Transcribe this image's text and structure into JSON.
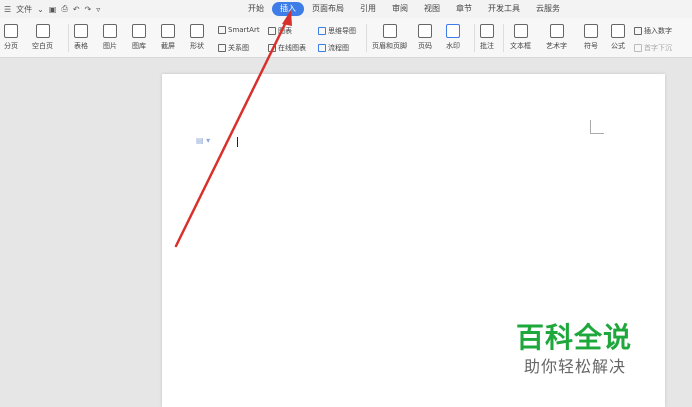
{
  "menubar": {
    "menu_label": "文件",
    "tabs": [
      {
        "label": "开始",
        "active": false
      },
      {
        "label": "插入",
        "active": true
      },
      {
        "label": "页面布局",
        "active": false
      },
      {
        "label": "引用",
        "active": false
      },
      {
        "label": "审阅",
        "active": false
      },
      {
        "label": "视图",
        "active": false
      },
      {
        "label": "章节",
        "active": false
      },
      {
        "label": "开发工具",
        "active": false
      },
      {
        "label": "云服务",
        "active": false
      }
    ]
  },
  "ribbon": {
    "page_break": "分页",
    "blank_page": "空白页",
    "table": "表格",
    "picture": "图片",
    "gallery": "图库",
    "screenshot": "截屏",
    "shape": "形状",
    "smartart": "SmartArt",
    "chart": "图表",
    "relation": "关系图",
    "online_chart": "在线图表",
    "mindmap": "思维导图",
    "flowchart": "流程图",
    "header_footer": "页眉和页脚",
    "page_number": "页码",
    "watermark": "水印",
    "comment": "批注",
    "textbox": "文本框",
    "wordart": "艺术字",
    "symbol": "符号",
    "formula": "公式",
    "insert_number": "插入数字",
    "first_sink": "首字下沉"
  },
  "watermark": {
    "title": "百科全说",
    "subtitle": "助你轻松解决"
  },
  "colors": {
    "accent": "#3e7ce8",
    "arrow": "#d9302c",
    "watermark_green": "#1ea83c"
  }
}
